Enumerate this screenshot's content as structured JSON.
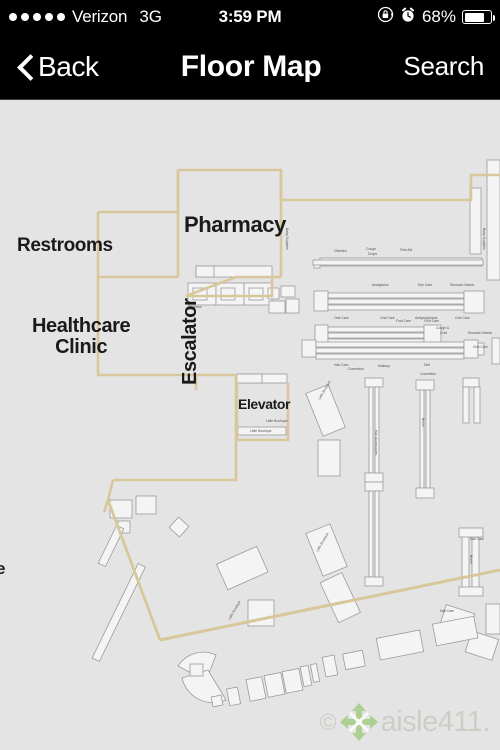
{
  "status_bar": {
    "signal_dots": 5,
    "carrier": "Verizon",
    "network": "3G",
    "time": "3:59 PM",
    "rotation_lock_icon": "rotation-lock-icon",
    "alarm_icon": "alarm-clock-icon",
    "battery_percent": "68%",
    "battery_level": 68
  },
  "nav_bar": {
    "back_label": "Back",
    "back_icon": "chevron-left-icon",
    "title": "Floor Map",
    "search_label": "Search"
  },
  "map": {
    "background_color": "#e4e4e4",
    "wall_color": "#d8c79a",
    "fixture_stroke": "#9a9a9a",
    "fixture_fill": "#f2f2f2",
    "rooms": [
      {
        "name": "Pharmacy",
        "label": "Pharmacy"
      },
      {
        "name": "Restrooms",
        "label": "Restrooms"
      },
      {
        "name": "Healthcare Clinic",
        "label_line1": "Healthcare",
        "label_line2": "Clinic"
      },
      {
        "name": "Elevator",
        "label": "Elevator"
      },
      {
        "name": "Escalator",
        "label": "Escalator"
      }
    ],
    "clipped_edge_label": "e",
    "aisle_labels": [
      "Vitamins",
      "Cough Drops",
      "First Aid",
      "Analgesics",
      "Eye Care",
      "Stomach Needs",
      "Oral Care",
      "Oral Care",
      "Antiperspirants",
      "Oral Care",
      "Foot Care",
      "Foot Care",
      "Hair Care",
      "Makeup",
      "Diet",
      "Cough & Cold",
      "Cosmetics",
      "Cosmetics",
      "Baby Supplies",
      "Hair Accessories",
      "Brush",
      "Brush",
      "Little Boutique",
      "Little Boutique",
      "Little Boutique",
      "Nail Care",
      "Nail Care",
      "Little Boutique"
    ]
  },
  "watermark": {
    "copyright": "©",
    "brand": "aisle411.",
    "logo_icon": "aisle411-arrows-logo",
    "logo_color": "#a9cf8e",
    "text_color": "#c9cec5"
  }
}
